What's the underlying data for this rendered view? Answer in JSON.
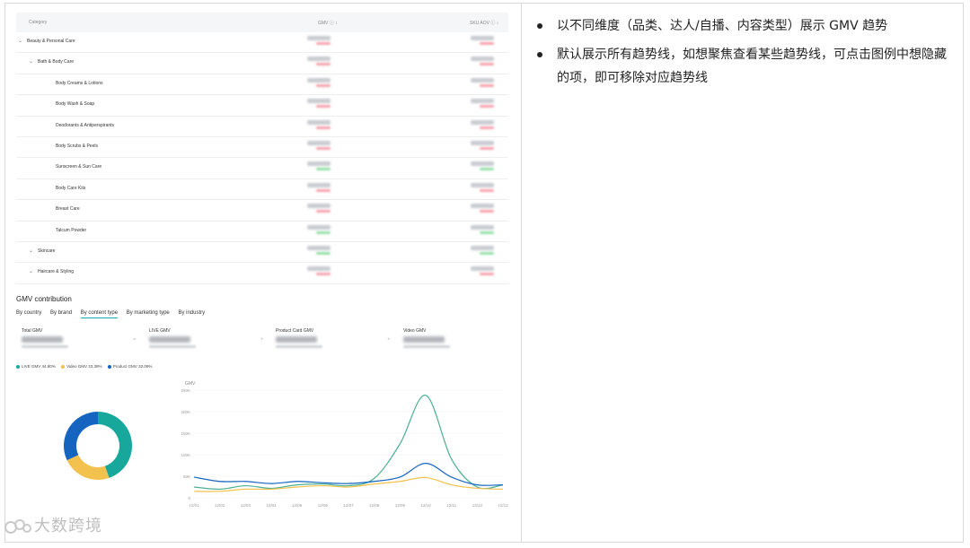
{
  "table": {
    "headers": {
      "category": "Category",
      "gmv": "GMV ⓘ ↕",
      "aov": "SKU AOV ⓘ ↕"
    },
    "rows": [
      {
        "level": 0,
        "expand": "⌄",
        "name": "Beauty & Personal Care",
        "delta_color": "red"
      },
      {
        "level": 1,
        "expand": "⌄",
        "name": "Bath & Body Care",
        "delta_color": "red"
      },
      {
        "level": 2,
        "expand": "",
        "name": "Body Creams & Lotions",
        "delta_color": "red"
      },
      {
        "level": 2,
        "expand": "",
        "name": "Body Wash & Soap",
        "delta_color": "red"
      },
      {
        "level": 2,
        "expand": "",
        "name": "Deodorants & Antiperspirants",
        "delta_color": "red"
      },
      {
        "level": 2,
        "expand": "",
        "name": "Body Scrubs & Peels",
        "delta_color": "red"
      },
      {
        "level": 2,
        "expand": "",
        "name": "Sunscreen & Sun Care",
        "delta_color": "green"
      },
      {
        "level": 2,
        "expand": "",
        "name": "Body Care Kits",
        "delta_color": "red"
      },
      {
        "level": 2,
        "expand": "",
        "name": "Breast Care",
        "delta_color": "red"
      },
      {
        "level": 2,
        "expand": "",
        "name": "Talcum Powder",
        "delta_color": "green"
      },
      {
        "level": 1,
        "expand": "⌄",
        "name": "Skincare",
        "delta_color": "green"
      },
      {
        "level": 1,
        "expand": "⌄",
        "name": "Haircare & Styling",
        "delta_color": "red"
      }
    ]
  },
  "gmv_contribution": {
    "title": "GMV contribution",
    "tabs": [
      {
        "label": "By country",
        "active": false
      },
      {
        "label": "By brand",
        "active": false
      },
      {
        "label": "By content type",
        "active": true
      },
      {
        "label": "By marketing type",
        "active": false
      },
      {
        "label": "By industry",
        "active": false
      }
    ],
    "kpis": [
      {
        "label": "Total GMV"
      },
      {
        "label": "LIVE GMV"
      },
      {
        "label": "Product Card GMV"
      },
      {
        "label": "Video GMV"
      }
    ],
    "kpi_separator": "=",
    "kpi_operator": "+",
    "legend": [
      {
        "name": "LIVE GMV",
        "pct": "44.80%",
        "color": "#17a89b"
      },
      {
        "name": "Video GMV",
        "pct": "23.39%",
        "color": "#f2c14e"
      },
      {
        "name": "Product GMV",
        "pct": "32.09%",
        "color": "#1565c0"
      }
    ]
  },
  "chart_data": [
    {
      "type": "pie",
      "series": [
        {
          "name": "LIVE GMV",
          "value": 44.8,
          "color": "#17a89b"
        },
        {
          "name": "Video GMV",
          "value": 23.39,
          "color": "#f2c14e"
        },
        {
          "name": "Product GMV",
          "value": 32.09,
          "color": "#1565c0"
        }
      ],
      "style": "donut"
    },
    {
      "type": "line",
      "title": "",
      "ylabel": "GMV",
      "x": [
        "12/01",
        "12/02",
        "12/03",
        "12/04",
        "12/05",
        "12/06",
        "12/07",
        "12/08",
        "12/09",
        "12/10",
        "12/11",
        "12/12",
        "12/13"
      ],
      "y_ticks": [
        "0",
        "50K",
        "100K",
        "150K",
        "200K",
        "250K"
      ],
      "ylim": [
        0,
        250000
      ],
      "series": [
        {
          "name": "LIVE GMV",
          "color": "#4caf93",
          "values": [
            25000,
            20000,
            28000,
            22000,
            30000,
            32000,
            28000,
            45000,
            125000,
            238000,
            90000,
            25000,
            30000
          ]
        },
        {
          "name": "Video GMV",
          "color": "#f2c14e",
          "values": [
            15000,
            15000,
            20000,
            20000,
            25000,
            28000,
            25000,
            32000,
            38000,
            47000,
            30000,
            22000,
            20000
          ]
        },
        {
          "name": "Product GMV",
          "color": "#1565c0",
          "values": [
            48000,
            38000,
            38000,
            33000,
            38000,
            35000,
            33000,
            38000,
            48000,
            80000,
            48000,
            30000,
            30000
          ]
        }
      ]
    }
  ],
  "watermark": {
    "text": "大数跨境"
  },
  "notes": [
    "以不同维度（品类、达人/自播、内容类型）展示 GMV 趋势",
    "默认展示所有趋势线，如想聚焦查看某些趋势线，可点击图例中想隐藏的项，即可移除对应趋势线"
  ]
}
